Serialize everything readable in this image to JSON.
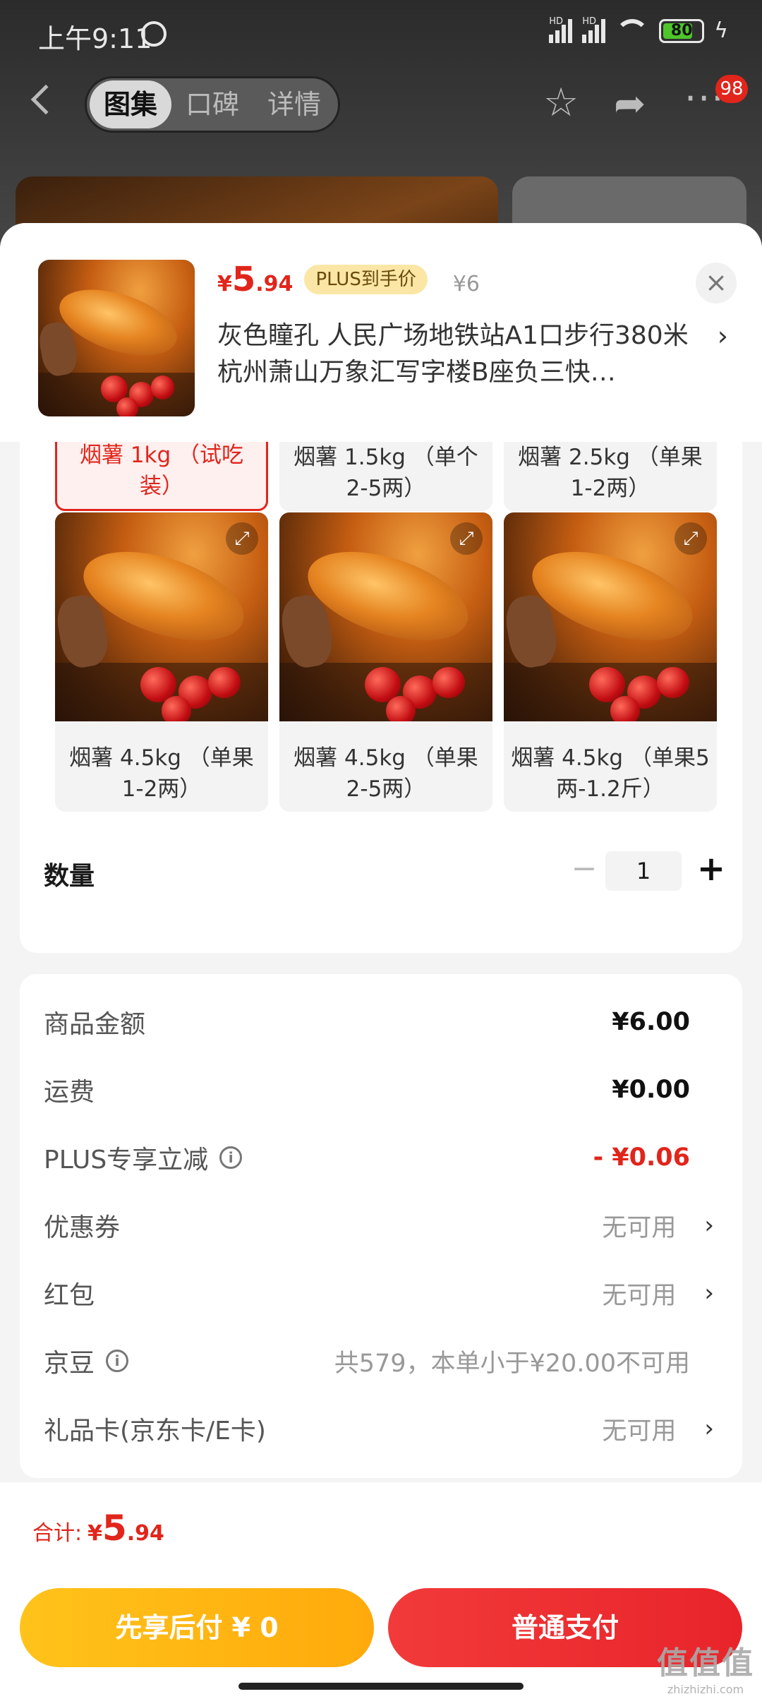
{
  "status_bar": {
    "time": "上午9:11",
    "battery": "80",
    "network_tags": [
      "HD",
      "HD"
    ]
  },
  "nav": {
    "tabs": [
      {
        "label": "图集",
        "active": true
      },
      {
        "label": "口碑",
        "active": false
      },
      {
        "label": "详情",
        "active": false
      }
    ],
    "badge_count": "98"
  },
  "sheet": {
    "price": {
      "symbol": "¥",
      "integer": "5",
      "decimal": ".94"
    },
    "plus_tag": "PLUS到手价",
    "original_price": "¥6",
    "address": "灰色瞳孔  人民广场地铁站A1口步行380米杭州萧山万象汇写字楼B座负三快…",
    "options": [
      {
        "label": "烟薯 1kg （试吃装）",
        "selected": true
      },
      {
        "label": "烟薯 1.5kg （单个2-5两）",
        "selected": false
      },
      {
        "label": "烟薯 2.5kg （单果1-2两）",
        "selected": false
      },
      {
        "label": "烟薯 4.5kg （单果1-2两）",
        "selected": false
      },
      {
        "label": "烟薯 4.5kg （单果2-5两）",
        "selected": false
      },
      {
        "label": "烟薯 4.5kg （单果5两-1.2斤）",
        "selected": false
      }
    ],
    "quantity_label": "数量",
    "quantity": "1",
    "fees": [
      {
        "label": "商品金额",
        "value": "¥6.00",
        "style": "normal",
        "info": false,
        "chevron": false
      },
      {
        "label": "运费",
        "value": "¥0.00",
        "style": "normal",
        "info": false,
        "chevron": false
      },
      {
        "label": "PLUS专享立减",
        "value": "- ¥0.06",
        "style": "red",
        "info": true,
        "chevron": false
      },
      {
        "label": "优惠券",
        "value": "无可用",
        "style": "gray",
        "info": false,
        "chevron": true
      },
      {
        "label": "红包",
        "value": "无可用",
        "style": "gray",
        "info": false,
        "chevron": true
      },
      {
        "label": "京豆",
        "value": "共579，本单小于¥20.00不可用",
        "style": "gray",
        "info": true,
        "chevron": false
      },
      {
        "label": "礼品卡(京东卡/E卡)",
        "value": "无可用",
        "style": "gray",
        "info": false,
        "chevron": true
      }
    ],
    "total": {
      "label": "合计:",
      "symbol": "¥",
      "integer": "5",
      "decimal": ".94"
    },
    "buttons": {
      "pay_later": "先享后付 ¥ 0",
      "pay": "普通支付"
    }
  },
  "watermark": {
    "cn": "值值值",
    "en": "zhizhizhi.com"
  },
  "colors": {
    "accent": "#e1251b",
    "gold": "#ffb512",
    "plus_tag_bg": "#fbe6a6"
  }
}
